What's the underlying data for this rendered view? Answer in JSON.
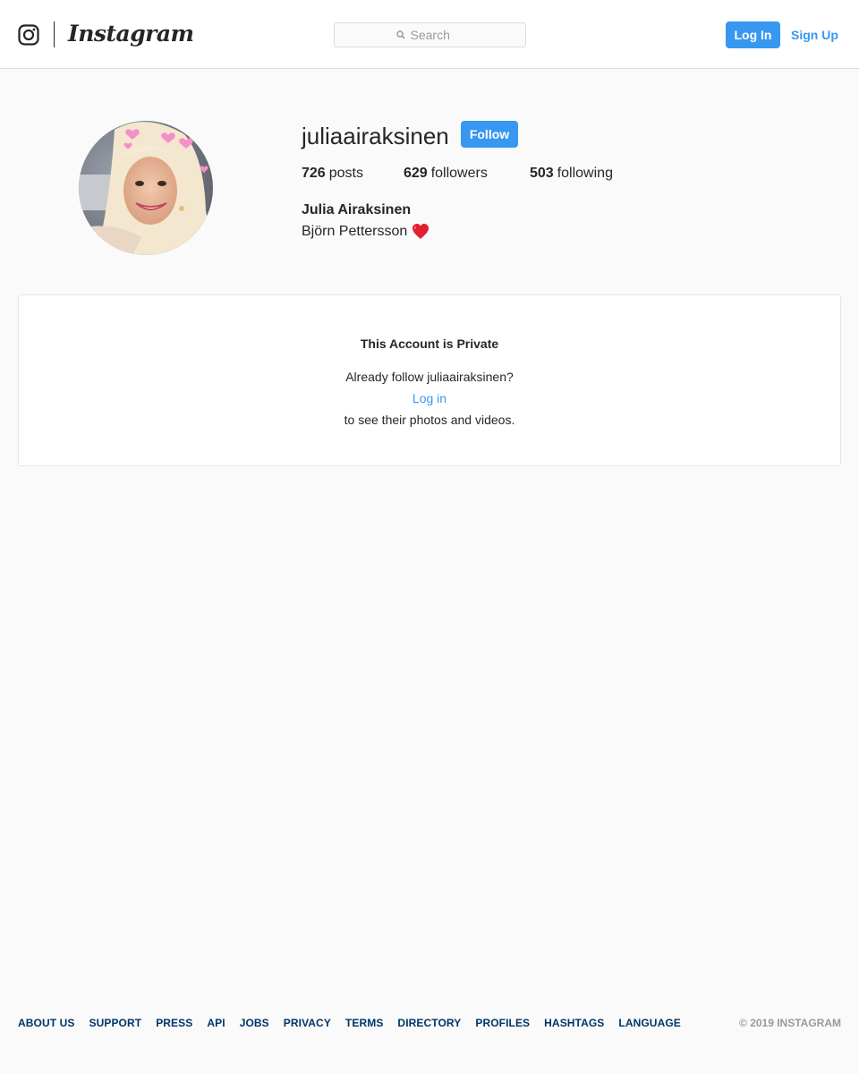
{
  "header": {
    "logo_text": "Instagram",
    "search_placeholder": "Search",
    "login_label": "Log In",
    "signup_label": "Sign Up",
    "accent_color": "#3897f0"
  },
  "profile": {
    "username": "juliaairaksinen",
    "follow_label": "Follow",
    "posts_count": "726",
    "posts_label": "posts",
    "followers_count": "629",
    "followers_label": "followers",
    "following_count": "503",
    "following_label": "following",
    "full_name": "Julia Airaksinen",
    "bio": "Björn Pettersson",
    "bio_emoji": "red-heart-icon"
  },
  "private_notice": {
    "title": "This Account is Private",
    "line1": "Already follow juliaairaksinen?",
    "login_link": "Log in",
    "line2": "to see their photos and videos."
  },
  "footer": {
    "links": [
      "ABOUT US",
      "SUPPORT",
      "PRESS",
      "API",
      "JOBS",
      "PRIVACY",
      "TERMS",
      "DIRECTORY",
      "PROFILES",
      "HASHTAGS",
      "LANGUAGE"
    ],
    "copyright": "© 2019 INSTAGRAM"
  }
}
